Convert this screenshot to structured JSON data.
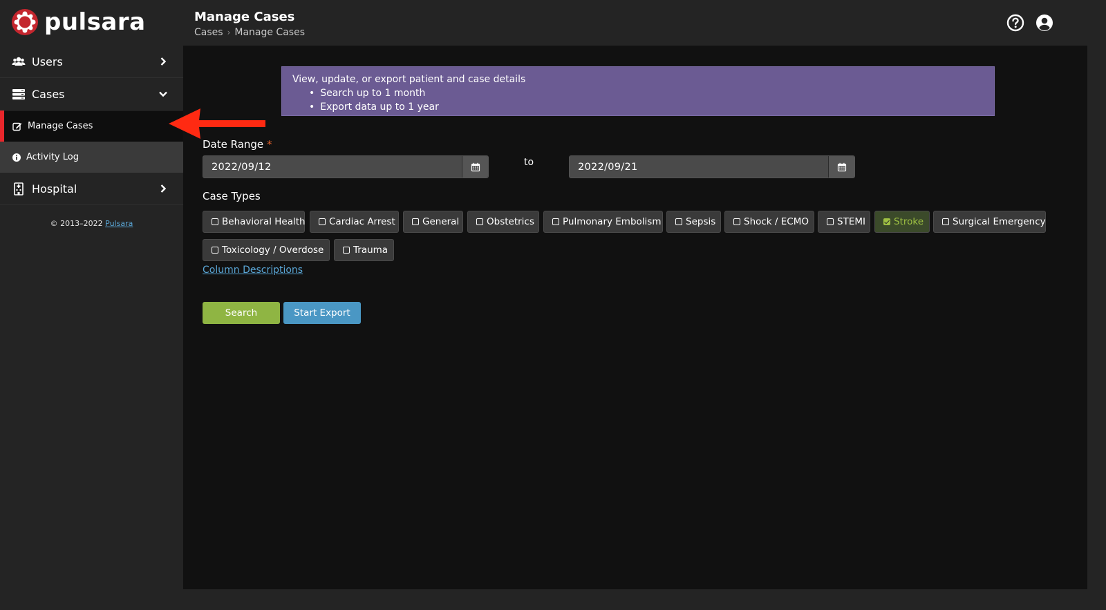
{
  "app": {
    "logo_text": "pulsara",
    "brand_color": "#c4262e"
  },
  "header": {
    "title": "Manage Cases",
    "breadcrumb": [
      "Cases",
      "Manage Cases"
    ],
    "icons": [
      "help-icon",
      "account-icon"
    ]
  },
  "sidebar": {
    "items": [
      {
        "label": "Users",
        "icon": "users-icon",
        "chevron": "right"
      },
      {
        "label": "Cases",
        "icon": "cases-icon",
        "chevron": "down"
      },
      {
        "label": "Hospital",
        "icon": "hospital-icon",
        "chevron": "right"
      }
    ],
    "subitems": [
      {
        "label": "Manage Cases",
        "icon": "edit-icon",
        "active": true
      },
      {
        "label": "Activity Log",
        "icon": "info-icon",
        "active": false
      }
    ],
    "copyright_prefix": "© 2013–2022",
    "copyright_link": "Pulsara",
    "active_color": "#e8262b"
  },
  "info_box": {
    "title": "View, update, or export patient and case details",
    "bullets": [
      "Search up to 1 month",
      "Export data up to 1 year"
    ],
    "color": "#6b5b93"
  },
  "date_range": {
    "label": "Date Range",
    "required_mark": "*",
    "start": "2022/09/12",
    "to_label": "to",
    "end": "2022/09/21"
  },
  "case_types": {
    "label": "Case Types",
    "items": [
      {
        "label": "Behavioral Health",
        "checked": false
      },
      {
        "label": "Cardiac Arrest",
        "checked": false
      },
      {
        "label": "General",
        "checked": false
      },
      {
        "label": "Obstetrics",
        "checked": false
      },
      {
        "label": "Pulmonary Embolism",
        "checked": false
      },
      {
        "label": "Sepsis",
        "checked": false
      },
      {
        "label": "Shock / ECMO",
        "checked": false
      },
      {
        "label": "STEMI",
        "checked": false
      },
      {
        "label": "Stroke",
        "checked": true
      },
      {
        "label": "Surgical Emergency",
        "checked": false
      },
      {
        "label": "Toxicology / Overdose",
        "checked": false
      },
      {
        "label": "Trauma",
        "checked": false
      }
    ]
  },
  "column_descriptions_link": "Column Descriptions",
  "actions": {
    "search_label": "Search",
    "export_label": "Start Export",
    "search_color": "#8fb543",
    "export_color": "#4a97c4"
  },
  "annotation": {
    "arrow_color": "#ff2a12"
  }
}
